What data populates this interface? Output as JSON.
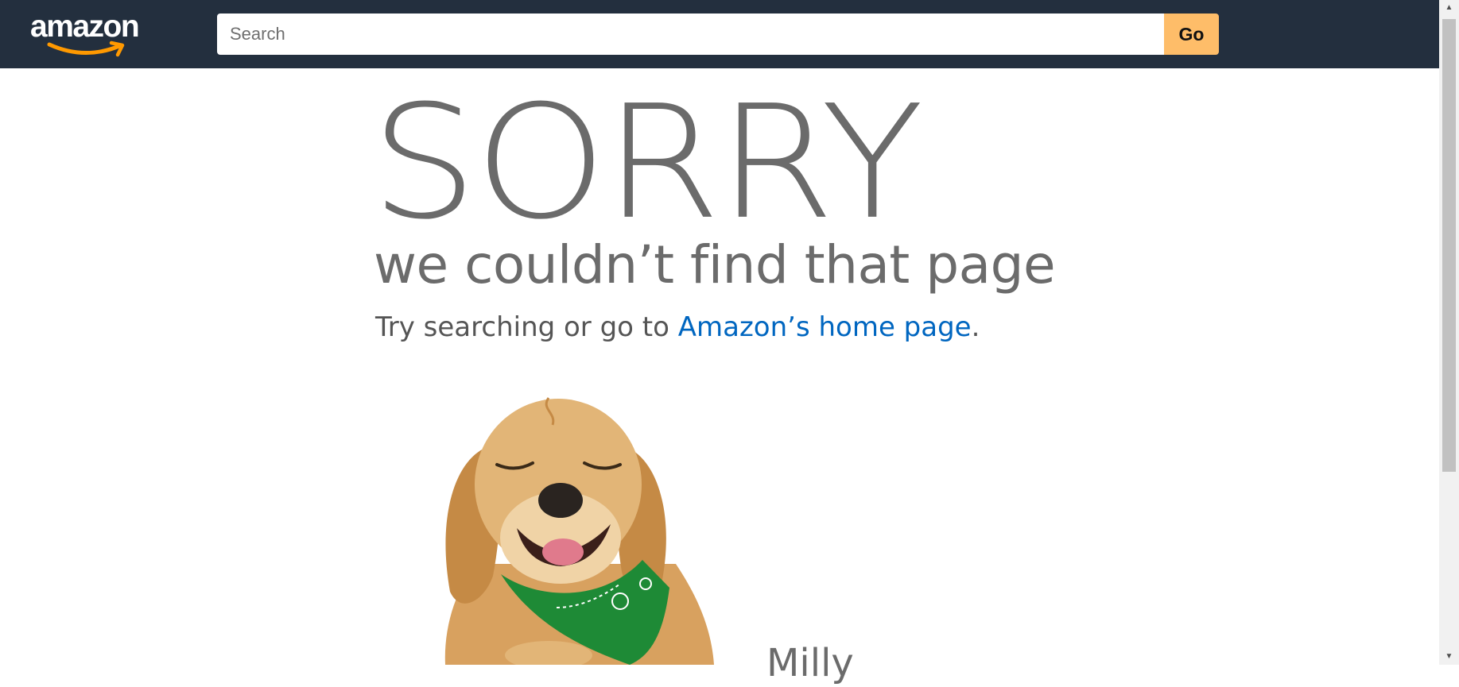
{
  "header": {
    "logo_text": "amazon",
    "search": {
      "placeholder": "Search",
      "value": ""
    },
    "go_label": "Go"
  },
  "main": {
    "heading": "SORRY",
    "subheading": "we couldn’t find that page",
    "try_prefix": "Try searching or go to ",
    "home_link": "Amazon’s home page",
    "try_suffix": ".",
    "dog_name": "Milly"
  },
  "colors": {
    "header_bg": "#232f3e",
    "go_button": "#febd69",
    "link": "#0066c0",
    "text": "#6b6b6b"
  },
  "icons": {
    "up": "scroll-up-arrow",
    "down": "scroll-down-arrow"
  }
}
